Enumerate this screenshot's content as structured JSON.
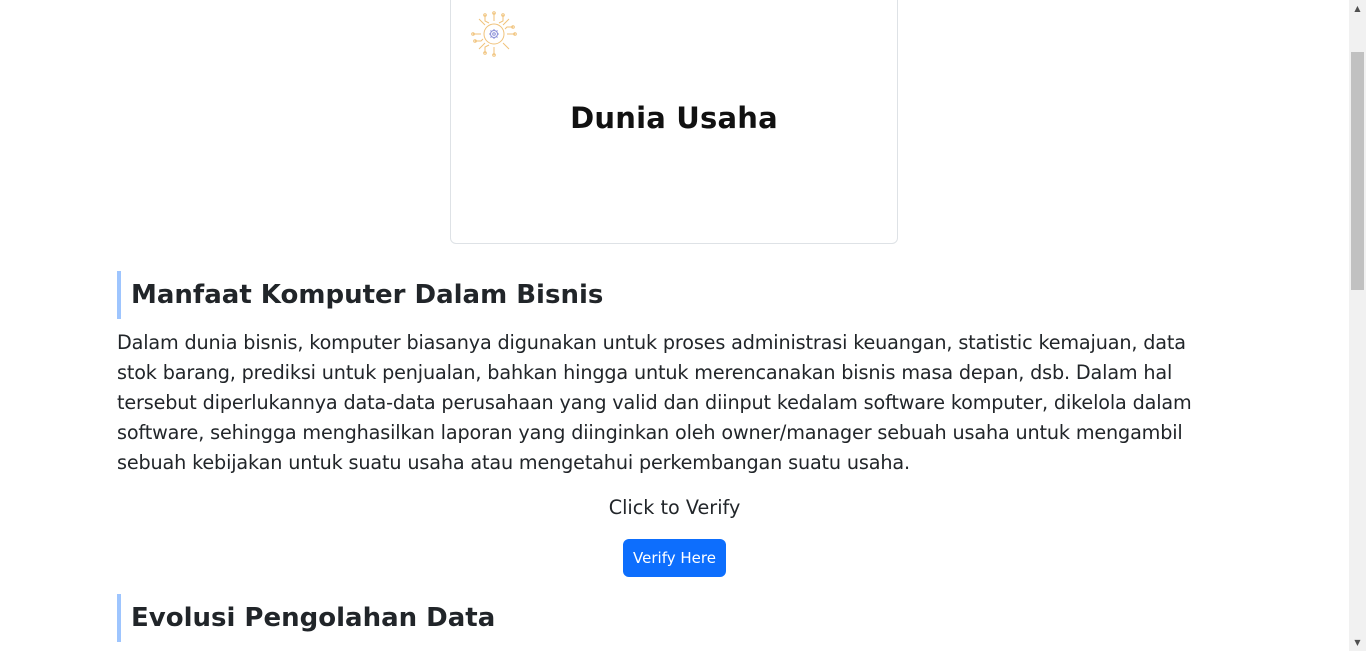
{
  "card": {
    "title": "Dunia Usaha",
    "icon": "circuit-gear-icon"
  },
  "section1": {
    "heading": "Manfaat Komputer Dalam Bisnis",
    "paragraph": "Dalam dunia bisnis, komputer biasanya digunakan untuk proses administrasi keuangan, statistic kemajuan, data stok barang, prediksi untuk penjualan, bahkan hingga untuk merencanakan bisnis masa depan, dsb. Dalam hal tersebut diperlukannya data-data perusahaan yang valid dan diinput kedalam software komputer, dikelola dalam software, sehingga menghasilkan laporan yang diinginkan oleh owner/manager sebuah usaha untuk mengambil sebuah kebijakan untuk suatu usaha atau mengetahui perkembangan suatu usaha."
  },
  "verify": {
    "prompt": "Click to Verify",
    "button_label": "Verify Here"
  },
  "section2": {
    "heading": "Evolusi Pengolahan Data"
  },
  "colors": {
    "accent": "#0d6efd",
    "heading_border": "#9ec5fe",
    "icon_orange": "#f0c27a",
    "icon_blue": "#8a8fd8"
  }
}
